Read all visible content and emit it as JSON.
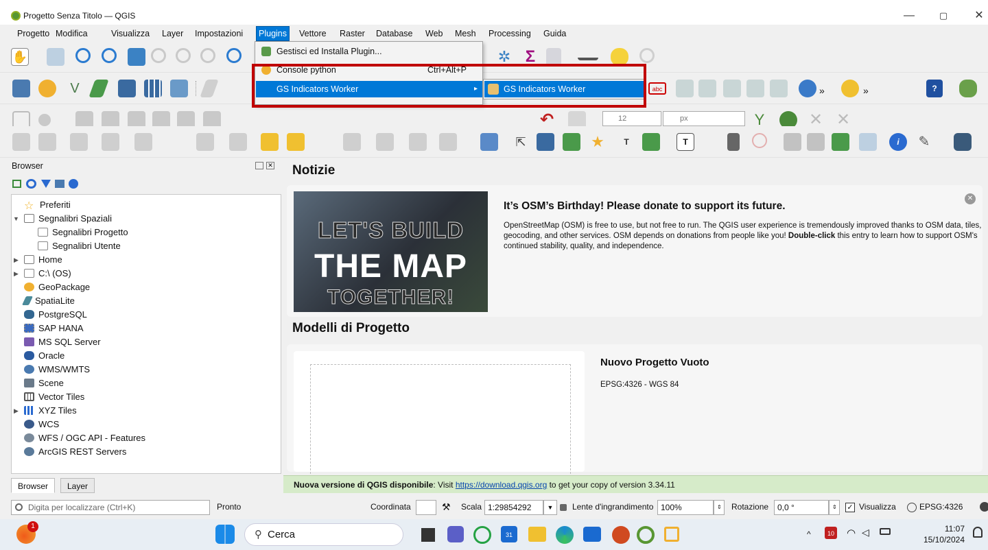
{
  "window": {
    "title": "Progetto Senza Titolo — QGIS",
    "minimize": "—",
    "restore": "▢",
    "close": "✕"
  },
  "menubar": [
    "Progetto",
    "Modifica",
    "Visualizza",
    "Layer",
    "Impostazioni",
    "Plugins",
    "Vettore",
    "Raster",
    "Database",
    "Web",
    "Mesh",
    "Processing",
    "Guida"
  ],
  "plugins_menu": {
    "items": [
      {
        "label": "Gestisci ed Installa Plugin...",
        "shortcut": ""
      },
      {
        "label": "Console python",
        "shortcut": "Ctrl+Alt+P"
      },
      {
        "label": "GS Indicators Worker",
        "shortcut": "",
        "arrow": "▸"
      }
    ],
    "submenu_item": "GS Indicators Worker"
  },
  "toolbar": {
    "label_size": "12",
    "label_unit": "px",
    "expand": "»",
    "help": "?"
  },
  "browser": {
    "title": "Browser",
    "tree": [
      "Preferiti",
      "Segnalibri Spaziali",
      "Segnalibri Progetto",
      "Segnalibri Utente",
      "Home",
      "C:\\ (OS)",
      "GeoPackage",
      "SpatiaLite",
      "PostgreSQL",
      "SAP HANA",
      "MS SQL Server",
      "Oracle",
      "WMS/WMTS",
      "Scene",
      "Vector Tiles",
      "XYZ Tiles",
      "WCS",
      "WFS / OGC API - Features",
      "ArcGIS REST Servers"
    ],
    "tabs": [
      "Browser",
      "Layer"
    ]
  },
  "news": {
    "heading": "Notizie",
    "image_lines": [
      "LET'S BUILD",
      "THE MAP",
      "TOGETHER!"
    ],
    "title": "It’s OSM’s Birthday! Please donate to support its future.",
    "body_1": "OpenStreetMap (OSM) is free to use, but not free to run. The QGIS user experience is tremendously improved thanks to OSM data, tiles, geocoding, and other services. OSM depends on donations from people like you! ",
    "body_bold": "Double-click",
    "body_2": " this entry to learn how to support OSM's continued stability, quality, and independence.",
    "close": "✕"
  },
  "templates": {
    "heading": "Modelli di Progetto",
    "title": "Nuovo Progetto Vuoto",
    "crs": "EPSG:4326 - WGS 84"
  },
  "update": {
    "bold": "Nuova versione di QGIS disponibile",
    "text_1": ": Visit ",
    "link": "https://download.qgis.org",
    "text_2": " to get your copy of version 3.34.11"
  },
  "status": {
    "locator_placeholder": "Digita per localizzare (Ctrl+K)",
    "ready": "Pronto",
    "coord_label": "Coordinata",
    "scale_label": "Scala",
    "scale_value": "1:29854292",
    "magnifier_label": "Lente d'ingrandimento",
    "magnifier_value": "100%",
    "rotation_label": "Rotazione",
    "rotation_value": "0,0 °",
    "render_label": "Visualizza",
    "crs": "EPSG:4326"
  },
  "taskbar": {
    "search": "Cerca",
    "time": "11:07",
    "date": "15/10/2024",
    "badge": "1",
    "calendar_day": "31",
    "widget_day": "10"
  },
  "colors": {
    "accent": "#0078d7",
    "highlight_box": "#c00000",
    "update_bar": "#d6ebc9"
  }
}
